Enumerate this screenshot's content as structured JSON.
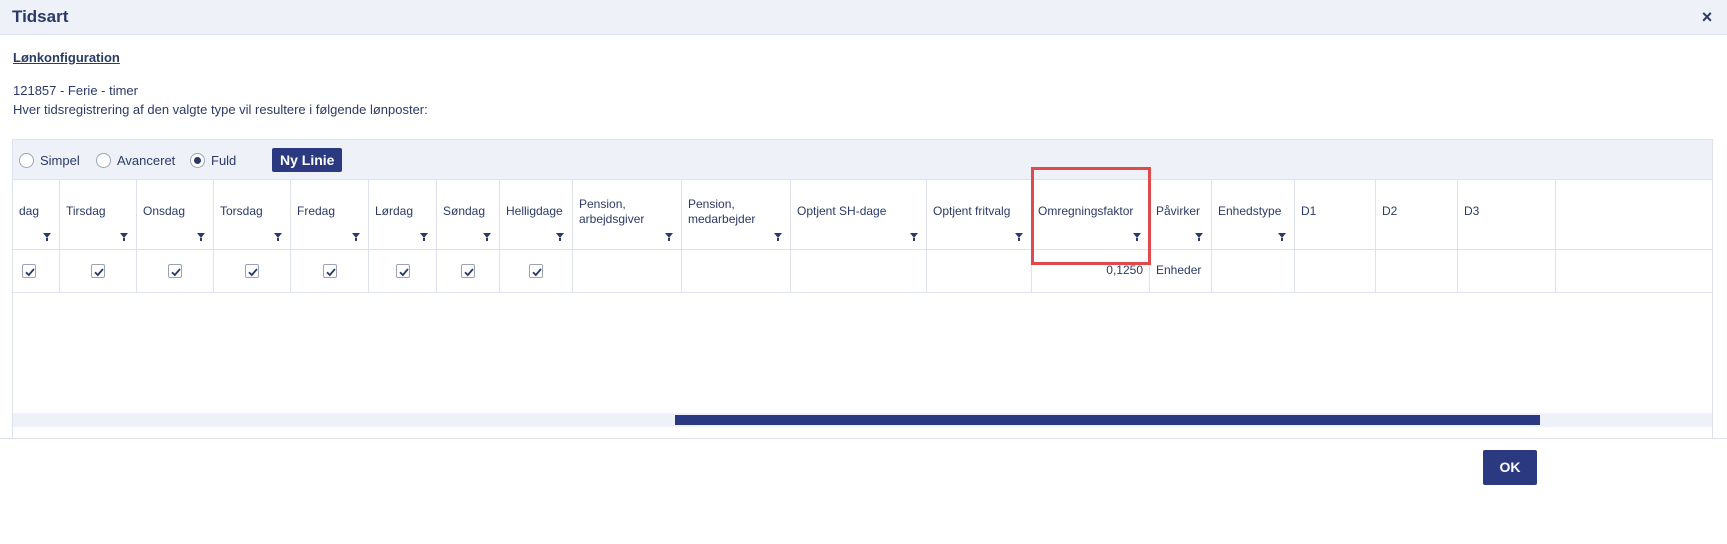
{
  "dialog": {
    "title": "Tidsart",
    "close_symbol": "×"
  },
  "section": {
    "link_label": "Lønkonfiguration",
    "info_line1": "121857 - Ferie - timer",
    "info_line2": "Hver tidsregistrering af den valgte type vil resultere i følgende lønposter:"
  },
  "toolbar": {
    "radio_simple": "Simpel",
    "radio_advanced": "Avanceret",
    "radio_full": "Fuld",
    "selected": "Fuld",
    "new_line_button": "Ny Linie"
  },
  "grid": {
    "columns": [
      {
        "label": "dag",
        "filter": true
      },
      {
        "label": "Tirsdag",
        "filter": true
      },
      {
        "label": "Onsdag",
        "filter": true
      },
      {
        "label": "Torsdag",
        "filter": true
      },
      {
        "label": "Fredag",
        "filter": true
      },
      {
        "label": "Lørdag",
        "filter": true
      },
      {
        "label": "Søndag",
        "filter": true
      },
      {
        "label": "Helligdage",
        "filter": true
      },
      {
        "label": "Pension, arbejdsgiver",
        "filter": true
      },
      {
        "label": "Pension, medarbejder",
        "filter": true
      },
      {
        "label": "Optjent SH-dage",
        "filter": true
      },
      {
        "label": "Optjent fritvalg",
        "filter": true
      },
      {
        "label": "Omregningsfaktor",
        "filter": true
      },
      {
        "label": "Påvirker",
        "filter": true
      },
      {
        "label": "Enhedstype",
        "filter": true
      },
      {
        "label": "D1",
        "filter": false
      },
      {
        "label": "D2",
        "filter": false
      },
      {
        "label": "D3",
        "filter": false
      }
    ],
    "row": {
      "mandag_checked": true,
      "tirsdag_checked": true,
      "onsdag_checked": true,
      "torsdag_checked": true,
      "fredag_checked": true,
      "lordag_checked": true,
      "sondag_checked": true,
      "helligdage_checked": true,
      "pension_arbejdsgiver": "",
      "pension_medarbejder": "",
      "optjent_sh_dage": "",
      "optjent_fritvalg": "",
      "omregningsfaktor": "0,1250",
      "pavirker": "Enheder",
      "enhedstype": "",
      "d1": "",
      "d2": "",
      "d3": ""
    }
  },
  "footer": {
    "ok_button": "OK"
  },
  "colors": {
    "primary": "#2b3a80",
    "text": "#2b3a67",
    "panel_bg": "#eef1f8",
    "highlight": "#e04a4a"
  }
}
